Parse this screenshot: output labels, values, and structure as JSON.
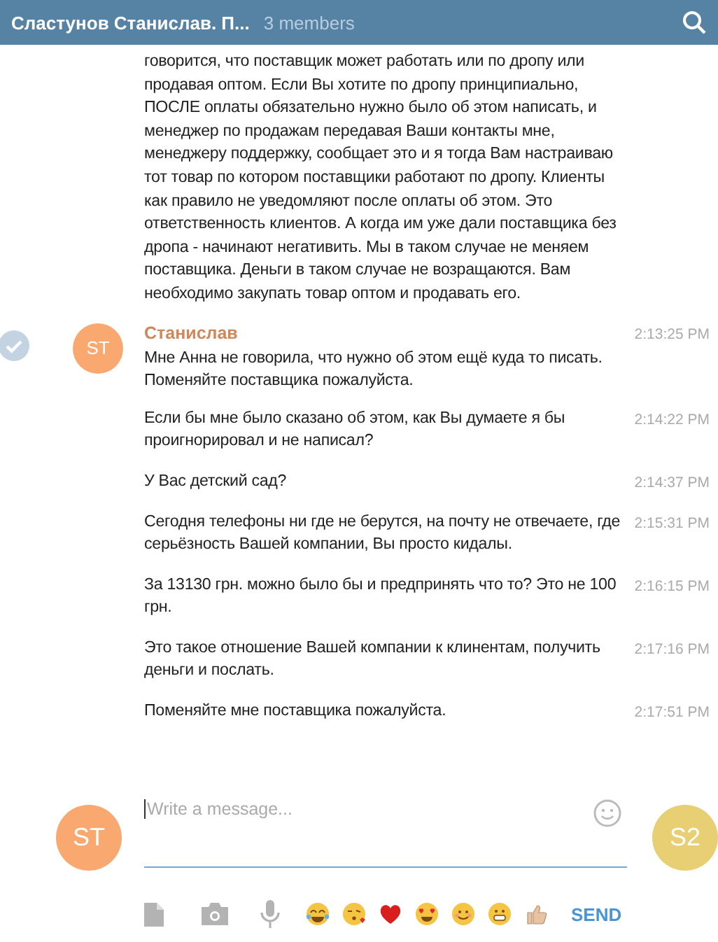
{
  "header": {
    "title": "Сластунов Станислав. П...",
    "subtitle": "3 members"
  },
  "messages": [
    {
      "text": "говорится, что поставщик может работать или по дропу или продавая оптом. Если Вы хотите по дропу принципиально, ПОСЛЕ оплаты обязательно нужно было об этом написать, и менеджер по продажам передавая Ваши контакты мне, менеджеру поддержку, сообщает это и я тогда Вам настраиваю тот товар по котором поставщики работают по дропу. Клиенты как правило не уведомляют после оплаты об этом. Это ответственность клиентов. А когда им уже дали поставщика без дропа - начинают негативить. Мы в таком случае не меняем поставщика. Деньги в таком случае не возращаются. Вам необходимо закупать товар оптом и продавать его."
    },
    {
      "selected": true,
      "avatar": "ST",
      "color": "#f9a870",
      "sender": "Станислав",
      "time": "2:13:25 PM",
      "text": "Мне Анна не говорила, что нужно об этом ещё куда то писать. Поменяйте поставщика пожалуйста."
    },
    {
      "time": "2:14:22 PM",
      "text": "Если бы мне было сказано об этом, как Вы думаете я бы проигнорировал и не написал?"
    },
    {
      "time": "2:14:37 PM",
      "text": "У Вас детский сад?"
    },
    {
      "time": "2:15:31 PM",
      "text": "Сегодня телефоны ни где не берутся, на почту не отвечаете, где серьёзность Вашей компании, Вы просто кидалы."
    },
    {
      "time": "2:16:15 PM",
      "text": "За 13130 грн. можно было бы и предпринять что то? Это не 100 грн."
    },
    {
      "time": "2:17:16 PM",
      "text": "Это такое отношение Вашей компании к клинентам, получить деньги и послать."
    },
    {
      "time": "2:17:51 PM",
      "text": "Поменяйте мне поставщика пожалуйста."
    }
  ],
  "composer": {
    "avatars": [
      {
        "initials": "ST",
        "color": "#f9a870"
      },
      {
        "initials": "S2",
        "color": "#e8cf73"
      }
    ],
    "placeholder": "Write a message...",
    "send": "SEND"
  }
}
